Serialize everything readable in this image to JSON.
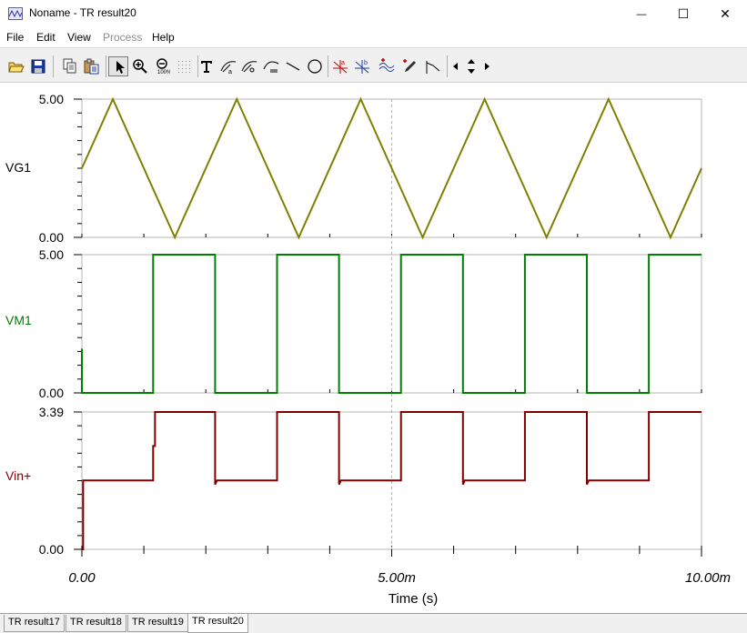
{
  "window": {
    "title": "Noname - TR result20",
    "minimize_glyph": "—",
    "maximize_glyph": "☐",
    "close_glyph": "✕"
  },
  "menu": {
    "items": [
      {
        "label": "File",
        "enabled": true
      },
      {
        "label": "Edit",
        "enabled": true
      },
      {
        "label": "View",
        "enabled": true
      },
      {
        "label": "Process",
        "enabled": false
      },
      {
        "label": "Help",
        "enabled": true
      }
    ]
  },
  "toolbar": {
    "buttons": [
      "open-icon",
      "save-icon",
      "copy-icon",
      "paste-icon",
      "select-pointer-icon",
      "zoom-in-icon",
      "zoom-100-icon",
      "grid-icon",
      "text-tool-icon",
      "curve-label-icon",
      "curve-label-2-icon",
      "formula-label-icon",
      "line-tool-icon",
      "circle-tool-icon",
      "cursor-a-icon",
      "cursor-b-icon",
      "wave-icon",
      "probe-icon",
      "marker-icon",
      "arrow-left-icon",
      "arrow-updown-icon",
      "arrow-right-icon"
    ],
    "selected": "select-pointer-icon"
  },
  "tabs": [
    {
      "label": "TR result17",
      "active": false
    },
    {
      "label": "TR result18",
      "active": false
    },
    {
      "label": "TR result19",
      "active": false
    },
    {
      "label": "TR result20",
      "active": true
    }
  ],
  "colors": {
    "VG1": "#808000",
    "VM1": "#008000",
    "Vin+": "#800000",
    "grid": "#b4b4b4"
  },
  "chart_data": {
    "type": "line",
    "xlabel": "Time (s)",
    "x_ticks": [
      "0.00",
      "5.00m",
      "10.00m"
    ],
    "xlim": [
      0,
      0.01
    ],
    "cursor_x": 0.005,
    "panels": [
      {
        "name": "VG1",
        "ylim": [
          0,
          5
        ],
        "y_ticks": [
          "0.00",
          "5.00"
        ],
        "series": {
          "name": "VG1",
          "x": [
            0,
            0.0005,
            0.0015,
            0.0025,
            0.0035,
            0.0045,
            0.0055,
            0.0065,
            0.0075,
            0.0085,
            0.0095,
            0.01
          ],
          "y": [
            2.5,
            5,
            0,
            5,
            0,
            5,
            0,
            5,
            0,
            5,
            0,
            2.5
          ]
        }
      },
      {
        "name": "VM1",
        "ylim": [
          0,
          5
        ],
        "y_ticks": [
          "0.00",
          "5.00"
        ],
        "series": {
          "name": "VM1",
          "x": [
            0,
            0,
            2e-05,
            0.00115,
            0.00115,
            0.00215,
            0.00215,
            0.00315,
            0.00315,
            0.00415,
            0.00415,
            0.00515,
            0.00515,
            0.00615,
            0.00615,
            0.00715,
            0.00715,
            0.00815,
            0.00815,
            0.00915,
            0.00915,
            0.01
          ],
          "y": [
            1.6,
            0,
            0,
            0,
            5,
            5,
            0,
            0,
            5,
            5,
            0,
            0,
            5,
            5,
            0,
            0,
            5,
            5,
            0,
            0,
            5,
            5
          ]
        }
      },
      {
        "name": "Vin+",
        "ylim": [
          0,
          3.39
        ],
        "y_ticks": [
          "0.00",
          "3.39"
        ],
        "series": {
          "name": "Vin+",
          "x": [
            0,
            2e-05,
            2e-05,
            0.00115,
            0.00115,
            0.00118,
            0.00118,
            0.00215,
            0.00215,
            0.00218,
            0.00315,
            0.00315,
            0.00415,
            0.00415,
            0.00418,
            0.00515,
            0.00515,
            0.00615,
            0.00615,
            0.00618,
            0.00715,
            0.00715,
            0.00815,
            0.00815,
            0.00818,
            0.00915,
            0.00915,
            0.01
          ],
          "y": [
            0,
            0,
            1.7,
            1.7,
            2.55,
            2.55,
            3.39,
            3.39,
            1.6,
            1.7,
            1.7,
            3.39,
            3.39,
            1.6,
            1.7,
            1.7,
            3.39,
            3.39,
            1.6,
            1.7,
            1.7,
            3.39,
            3.39,
            1.6,
            1.7,
            1.7,
            3.39,
            3.39
          ]
        }
      }
    ]
  }
}
